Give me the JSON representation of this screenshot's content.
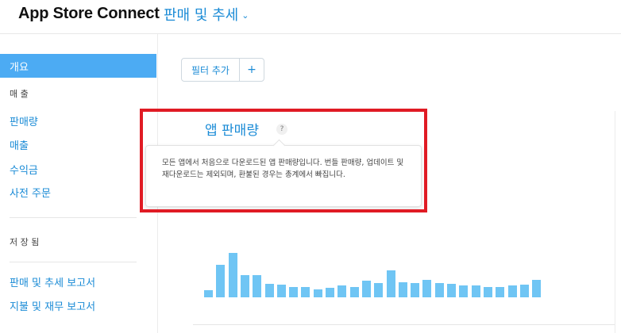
{
  "header": {
    "app_title": "App Store Connect",
    "section_title": "판매 및 추세",
    "chevron_icon": "chevron-down-icon"
  },
  "sidebar": {
    "items": [
      {
        "label": "개요",
        "active": true
      },
      {
        "label": "판매량"
      },
      {
        "label": "매출"
      },
      {
        "label": "수익금"
      },
      {
        "label": "사전 주문"
      }
    ],
    "sales_section_label": "매 출",
    "saved_section_label": "저 장 됨",
    "report_links": [
      {
        "label": "판매 및 추세 보고서"
      },
      {
        "label": "지불 및 재무 보고서"
      }
    ]
  },
  "toolbar": {
    "add_filter_label": "필터 추가",
    "plus_label": "+"
  },
  "card": {
    "title": "앱 판매량",
    "help_label": "?",
    "tooltip_text": "모든 앱에서 처음으로 다운로드된 앱 판매량입니다. 번들 판매량, 업데이트 및 재다운로드는 제외되며, 환불된 경우는 총계에서 빠집니다."
  },
  "colors": {
    "accent": "#1a8bd6",
    "active_bg": "#4cabf3",
    "bar": "#6fc5f4",
    "highlight": "#e01b24"
  },
  "chart_data": {
    "type": "bar",
    "values": [
      9,
      40,
      55,
      28,
      28,
      17,
      16,
      13,
      13,
      10,
      12,
      15,
      13,
      21,
      18,
      33,
      19,
      18,
      22,
      18,
      17,
      15,
      15,
      13,
      13,
      15,
      16,
      22
    ]
  }
}
